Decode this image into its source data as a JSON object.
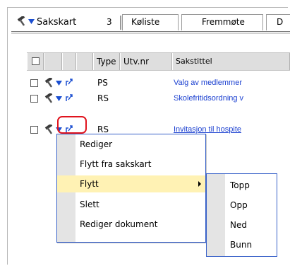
{
  "tabs": [
    {
      "label": "Sakskart",
      "count": "3",
      "active": true
    },
    {
      "label": "Køliste"
    },
    {
      "label": "Fremmøte"
    },
    {
      "label": "D"
    }
  ],
  "grid": {
    "columns": [
      "Type",
      "Utv.nr",
      "Sakstittel"
    ],
    "rows": [
      {
        "type": "PS",
        "utvnr": "",
        "title": "Valg av medlemmer"
      },
      {
        "type": "RS",
        "utvnr": "",
        "title": "Skolefritidsordning v"
      },
      {
        "type": "RS",
        "utvnr": "",
        "title": "Invitasjon til hospite"
      }
    ]
  },
  "context_menu": {
    "items": [
      "Rediger",
      "Flytt fra sakskart",
      "Flytt",
      "Slett",
      "Rediger dokument"
    ],
    "highlighted": "Flytt"
  },
  "submenu": {
    "items": [
      "Topp",
      "Opp",
      "Ned",
      "Bunn"
    ]
  },
  "colors": {
    "link": "#1a3fd0",
    "menu_border": "#3760c8",
    "highlight": "#fff2b4",
    "annotation_ring": "#e0141e"
  },
  "icons": {
    "action": "hammer-icon",
    "dropdown": "dropdown-arrow-icon",
    "document": "document-arrow-icon"
  }
}
